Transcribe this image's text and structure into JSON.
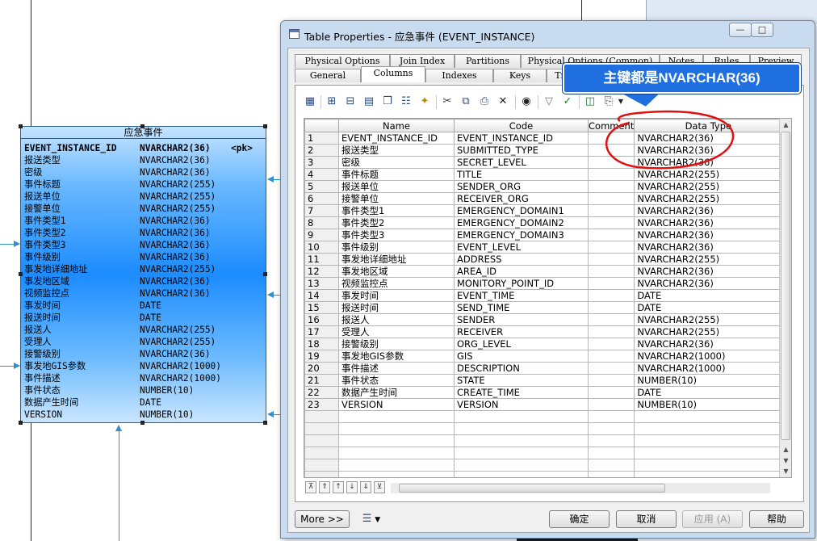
{
  "window": {
    "title": "Table Properties - 应急事件 (EVENT_INSTANCE)"
  },
  "tabs_row1": [
    "Physical Options",
    "Join Index",
    "Partitions",
    "Physical Options (Common)",
    "Notes",
    "Rules",
    "Preview"
  ],
  "tabs_row1_display": [
    "Physical Options",
    "Join Index",
    "Partitions",
    "Physical Options (Common)",
    "Notes",
    "Rules",
    "Preview"
  ],
  "tabs_row2": [
    "General",
    "Columns",
    "Indexes",
    "Keys",
    "Triggers"
  ],
  "columns_grid": {
    "headers": {
      "name": "Name",
      "code": "Code",
      "comment": "Comment",
      "data_type": "Data Type"
    },
    "rows": [
      {
        "num": "1",
        "name": "EVENT_INSTANCE_ID",
        "code": "EVENT_INSTANCE_ID",
        "comment": "",
        "type": "NVARCHAR2(36)"
      },
      {
        "num": "2",
        "name": "报送类型",
        "code": "SUBMITTED_TYPE",
        "comment": "",
        "type": "NVARCHAR2(36)"
      },
      {
        "num": "3",
        "name": "密级",
        "code": "SECRET_LEVEL",
        "comment": "",
        "type": "NVARCHAR2(36)"
      },
      {
        "num": "4",
        "name": "事件标题",
        "code": "TITLE",
        "comment": "",
        "type": "NVARCHAR2(255)"
      },
      {
        "num": "5",
        "name": "报送单位",
        "code": "SENDER_ORG",
        "comment": "",
        "type": "NVARCHAR2(255)"
      },
      {
        "num": "6",
        "name": "接警单位",
        "code": "RECEIVER_ORG",
        "comment": "",
        "type": "NVARCHAR2(255)"
      },
      {
        "num": "7",
        "name": "事件类型1",
        "code": "EMERGENCY_DOMAIN1",
        "comment": "",
        "type": "NVARCHAR2(36)"
      },
      {
        "num": "8",
        "name": "事件类型2",
        "code": "EMERGENCY_DOMAIN2",
        "comment": "",
        "type": "NVARCHAR2(36)"
      },
      {
        "num": "9",
        "name": "事件类型3",
        "code": "EMERGENCY_DOMAIN3",
        "comment": "",
        "type": "NVARCHAR2(36)"
      },
      {
        "num": "10",
        "name": "事件级别",
        "code": "EVENT_LEVEL",
        "comment": "",
        "type": "NVARCHAR2(36)"
      },
      {
        "num": "11",
        "name": "事发地详细地址",
        "code": "ADDRESS",
        "comment": "",
        "type": "NVARCHAR2(255)"
      },
      {
        "num": "12",
        "name": "事发地区域",
        "code": "AREA_ID",
        "comment": "",
        "type": "NVARCHAR2(36)"
      },
      {
        "num": "13",
        "name": "视频监控点",
        "code": "MONITORY_POINT_ID",
        "comment": "",
        "type": "NVARCHAR2(36)"
      },
      {
        "num": "14",
        "name": "事发时间",
        "code": "EVENT_TIME",
        "comment": "",
        "type": "DATE"
      },
      {
        "num": "15",
        "name": "报送时间",
        "code": "SEND_TIME",
        "comment": "",
        "type": "DATE"
      },
      {
        "num": "16",
        "name": "报送人",
        "code": "SENDER",
        "comment": "",
        "type": "NVARCHAR2(255)"
      },
      {
        "num": "17",
        "name": "受理人",
        "code": "RECEIVER",
        "comment": "",
        "type": "NVARCHAR2(255)"
      },
      {
        "num": "18",
        "name": "接警级别",
        "code": "ORG_LEVEL",
        "comment": "",
        "type": "NVARCHAR2(36)"
      },
      {
        "num": "19",
        "name": "事发地GIS参数",
        "code": "GIS",
        "comment": "",
        "type": "NVARCHAR2(1000)"
      },
      {
        "num": "20",
        "name": "事件描述",
        "code": "DESCRIPTION",
        "comment": "",
        "type": "NVARCHAR2(1000)"
      },
      {
        "num": "21",
        "name": "事件状态",
        "code": "STATE",
        "comment": "",
        "type": "NUMBER(10)"
      },
      {
        "num": "22",
        "name": "数据产生时间",
        "code": "CREATE_TIME",
        "comment": "",
        "type": "DATE"
      },
      {
        "num": "23",
        "name": "VERSION",
        "code": "VERSION",
        "comment": "",
        "type": "NUMBER(10)"
      }
    ]
  },
  "buttons": {
    "more": "More >>",
    "ok": "确定",
    "cancel": "取消",
    "apply": "应用 (A)",
    "help": "帮助"
  },
  "callout": {
    "text": "主键都是NVARCHAR(36)",
    "color": "#1f6fe0"
  },
  "entity": {
    "title": "应急事件",
    "pk_label": "<pk>",
    "rows": [
      {
        "name": "EVENT_INSTANCE_ID",
        "type": "NVARCHAR2(36)"
      },
      {
        "name": "报送类型",
        "type": "NVARCHAR2(36)"
      },
      {
        "name": "密级",
        "type": "NVARCHAR2(36)"
      },
      {
        "name": "事件标题",
        "type": "NVARCHAR2(255)"
      },
      {
        "name": "报送单位",
        "type": "NVARCHAR2(255)"
      },
      {
        "name": "接警单位",
        "type": "NVARCHAR2(255)"
      },
      {
        "name": "事件类型1",
        "type": "NVARCHAR2(36)"
      },
      {
        "name": "事件类型2",
        "type": "NVARCHAR2(36)"
      },
      {
        "name": "事件类型3",
        "type": "NVARCHAR2(36)"
      },
      {
        "name": "事件级别",
        "type": "NVARCHAR2(36)"
      },
      {
        "name": "事发地详细地址",
        "type": "NVARCHAR2(255)"
      },
      {
        "name": "事发地区域",
        "type": "NVARCHAR2(36)"
      },
      {
        "name": "视频监控点",
        "type": "NVARCHAR2(36)"
      },
      {
        "name": "事发时间",
        "type": "DATE"
      },
      {
        "name": "报送时间",
        "type": "DATE"
      },
      {
        "name": "报送人",
        "type": "NVARCHAR2(255)"
      },
      {
        "name": "受理人",
        "type": "NVARCHAR2(255)"
      },
      {
        "name": "接警级别",
        "type": "NVARCHAR2(36)"
      },
      {
        "name": "事发地GIS参数",
        "type": "NVARCHAR2(1000)"
      },
      {
        "name": "事件描述",
        "type": "NVARCHAR2(1000)"
      },
      {
        "name": "事件状态",
        "type": "NUMBER(10)"
      },
      {
        "name": "数据产生时间",
        "type": "DATE"
      },
      {
        "name": "VERSION",
        "type": "NUMBER(10)"
      }
    ]
  },
  "toolbar_icons": [
    "properties-icon",
    "insert-row-icon",
    "add-row-icon",
    "add-columns-icon",
    "replicate-icon",
    "paste-as-shortcut-icon",
    "new-column-icon",
    "cut-icon",
    "copy-icon",
    "paste-icon",
    "delete-icon",
    "find-icon",
    "filter-icon",
    "check-icon",
    "excel-export-icon",
    "print-icon",
    "dropdown-arrow-icon"
  ],
  "colors": {
    "entity_blue": "#1c8cff",
    "annotation_red": "#e01010",
    "dialog_frame": "#c9dbee"
  }
}
